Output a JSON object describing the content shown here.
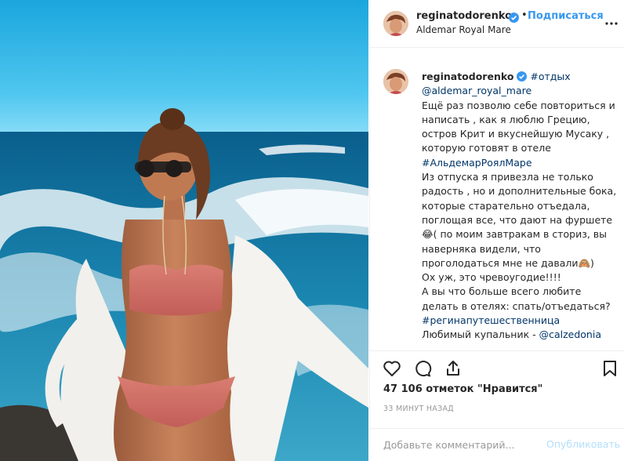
{
  "post": {
    "username": "reginatodorenko",
    "dot": "•",
    "follow_label": "Подписаться",
    "location": "Aldemar Royal Mare",
    "more_icon": "more-horizontal-icon"
  },
  "caption": {
    "username": "reginatodorenko",
    "tag_rest": "#отдых",
    "mention_hotel": "@aldemar_royal_mare",
    "p1": "Ещё раз позволю себе повториться и написать , как я люблю Грецию, остров Крит и вкуснейшую Мусаку , которую готовят в отеле",
    "tag_hotel": "#АльдемарРоялМаре",
    "p2": "Из отпуска я привезла не только радость , но и дополнительные бока, которые старательно отъедала, поглощая все, что дают на фуршете 😂( по моим завтракам в сториз, вы наверняка видели, что проголодаться мне не давали🙈)",
    "p3": "Ох уж, это чревоугодие!!!!",
    "p4": "А вы что больше всего любите делать в отелях: спать/отъедаться?",
    "tag_travel": "#регинапутешественница",
    "swimsuit_prefix": "Любимый купальник - ",
    "mention_brand": "@calzedonia"
  },
  "actions": {
    "like_icon": "heart-icon",
    "comment_icon": "comment-icon",
    "share_icon": "share-icon",
    "save_icon": "bookmark-icon"
  },
  "likes_text": "47 106 отметок \"Нравится\"",
  "time_text": "33 МИНУТ НАЗАД",
  "comment_box": {
    "placeholder": "Добавьте комментарий...",
    "publish_label": "Опубликовать"
  },
  "colors": {
    "link": "#3897f0",
    "hashtag": "#003569",
    "verified": "#3897f0",
    "publish_disabled": "#b2dffc"
  }
}
